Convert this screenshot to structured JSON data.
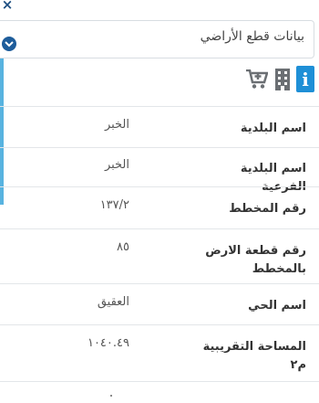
{
  "panel": {
    "close_glyph": "×",
    "title": "بيانات قطع الأراضي",
    "toolbar_info_glyph": "i"
  },
  "fields": [
    {
      "label": "اسم البلدية",
      "value": "الخبر"
    },
    {
      "label": "اسم البلدية الفرعية",
      "value": "الخبر"
    },
    {
      "label": "رقم المخطط",
      "value": "١٣٧/٢"
    },
    {
      "label": "رقم قطعة الارض بالمخطط",
      "value": "٨٥"
    },
    {
      "label": "اسم الحي",
      "value": "العقيق"
    },
    {
      "label": "المساحة التقريبية م٢",
      "value": "١٠٤٠.٤٩"
    }
  ],
  "colors": {
    "accent_dark": "#1e5d9b",
    "accent_light": "#58b3e0",
    "info_blue": "#1e8fd6"
  },
  "icons": [
    "close-icon",
    "chevron-down-icon",
    "info-icon",
    "building-icon",
    "add-to-cart-icon"
  ]
}
